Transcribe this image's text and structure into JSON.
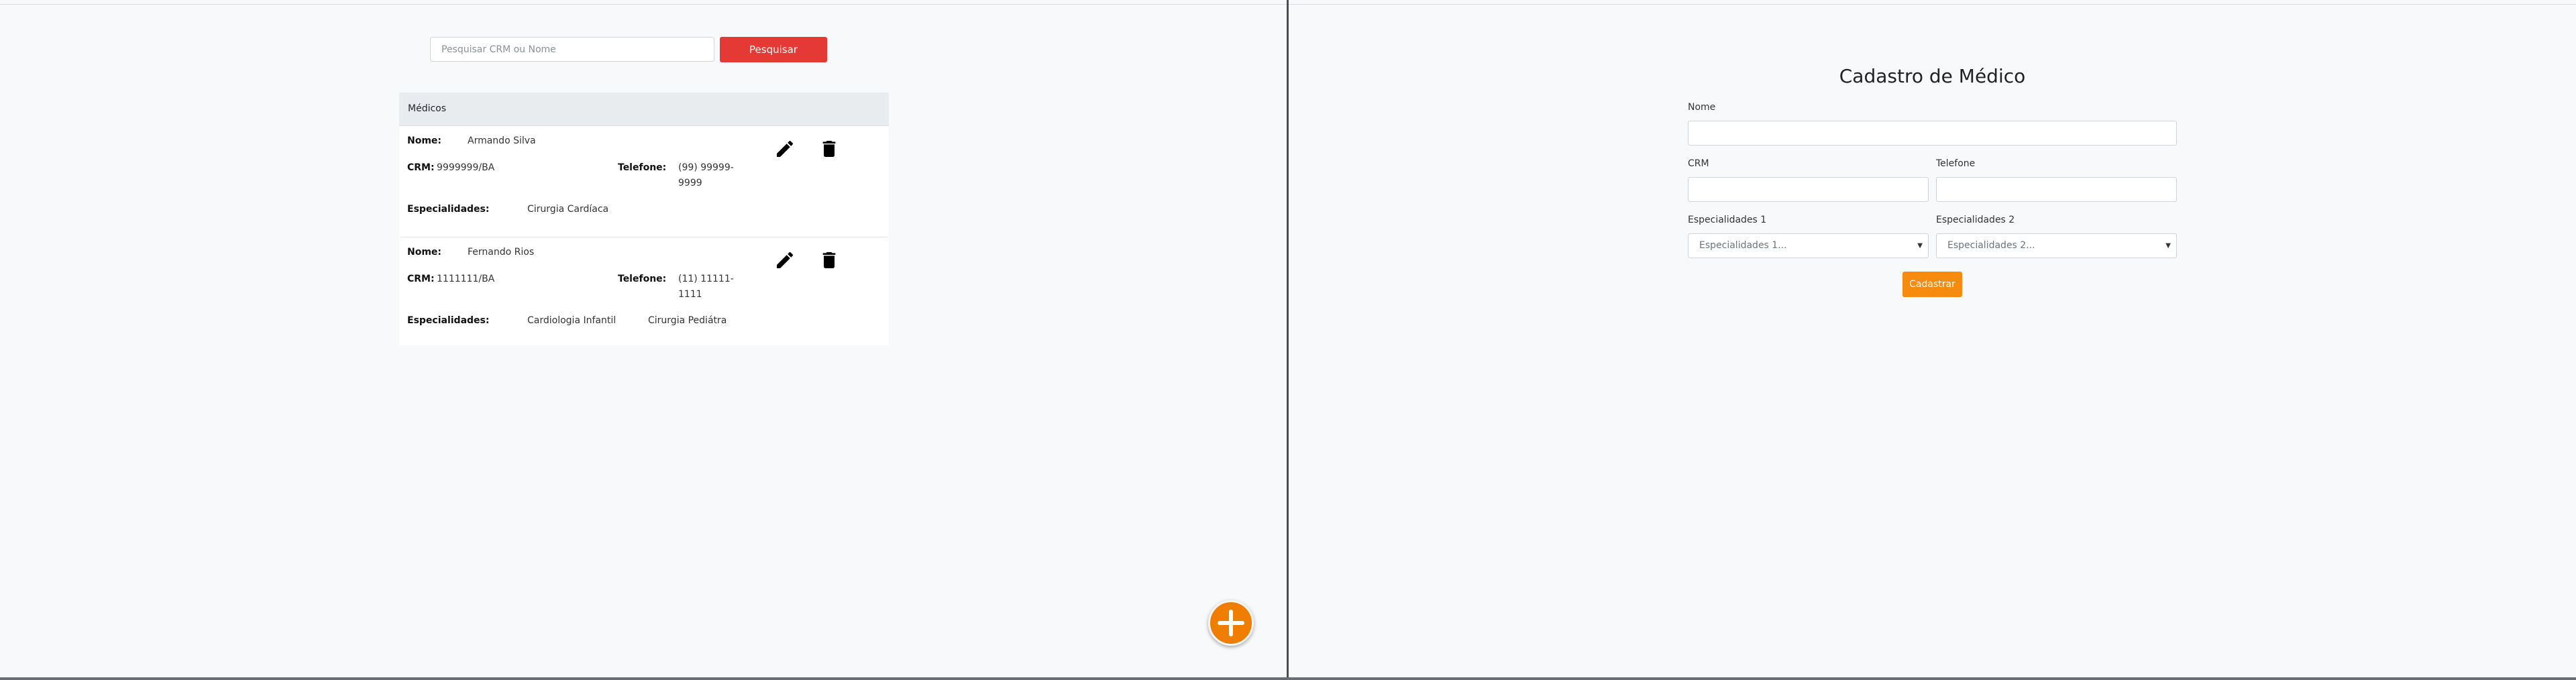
{
  "search": {
    "placeholder": "Pesquisar CRM ou Nome",
    "button_label": "Pesquisar"
  },
  "list": {
    "header": "Médicos",
    "labels": {
      "name": "Nome:",
      "crm": "CRM:",
      "phone": "Telefone:",
      "specialties": "Especialidades:"
    },
    "doctors": [
      {
        "name": "Armando Silva",
        "crm": "9999999/BA",
        "phone_line1": "(99) 99999-",
        "phone_line2": "9999",
        "specialty1": "Cirurgia Cardíaca",
        "specialty2": ""
      },
      {
        "name": "Fernando Rios",
        "crm": "1111111/BA",
        "phone_line1": "(11) 11111-",
        "phone_line2": "1111",
        "specialty1": "Cardiologia Infantil",
        "specialty2": "Cirurgia Pediátra"
      }
    ],
    "icons": {
      "edit": "pencil-icon",
      "delete": "trash-icon",
      "add": "plus-icon"
    }
  },
  "form": {
    "title": "Cadastro de Médico",
    "name_label": "Nome",
    "name_value": "",
    "crm_label": "CRM",
    "crm_value": "",
    "phone_label": "Telefone",
    "phone_value": "",
    "specialty1_label": "Especialidades 1",
    "specialty1_selected": "Especialidades 1...",
    "specialty2_label": "Especialidades 2",
    "specialty2_selected": "Especialidades 2...",
    "submit_label": "Cadastrar"
  },
  "colors": {
    "search_button": "#e53935",
    "submit_button": "#f68b0f",
    "fab": "#ef7d00"
  }
}
